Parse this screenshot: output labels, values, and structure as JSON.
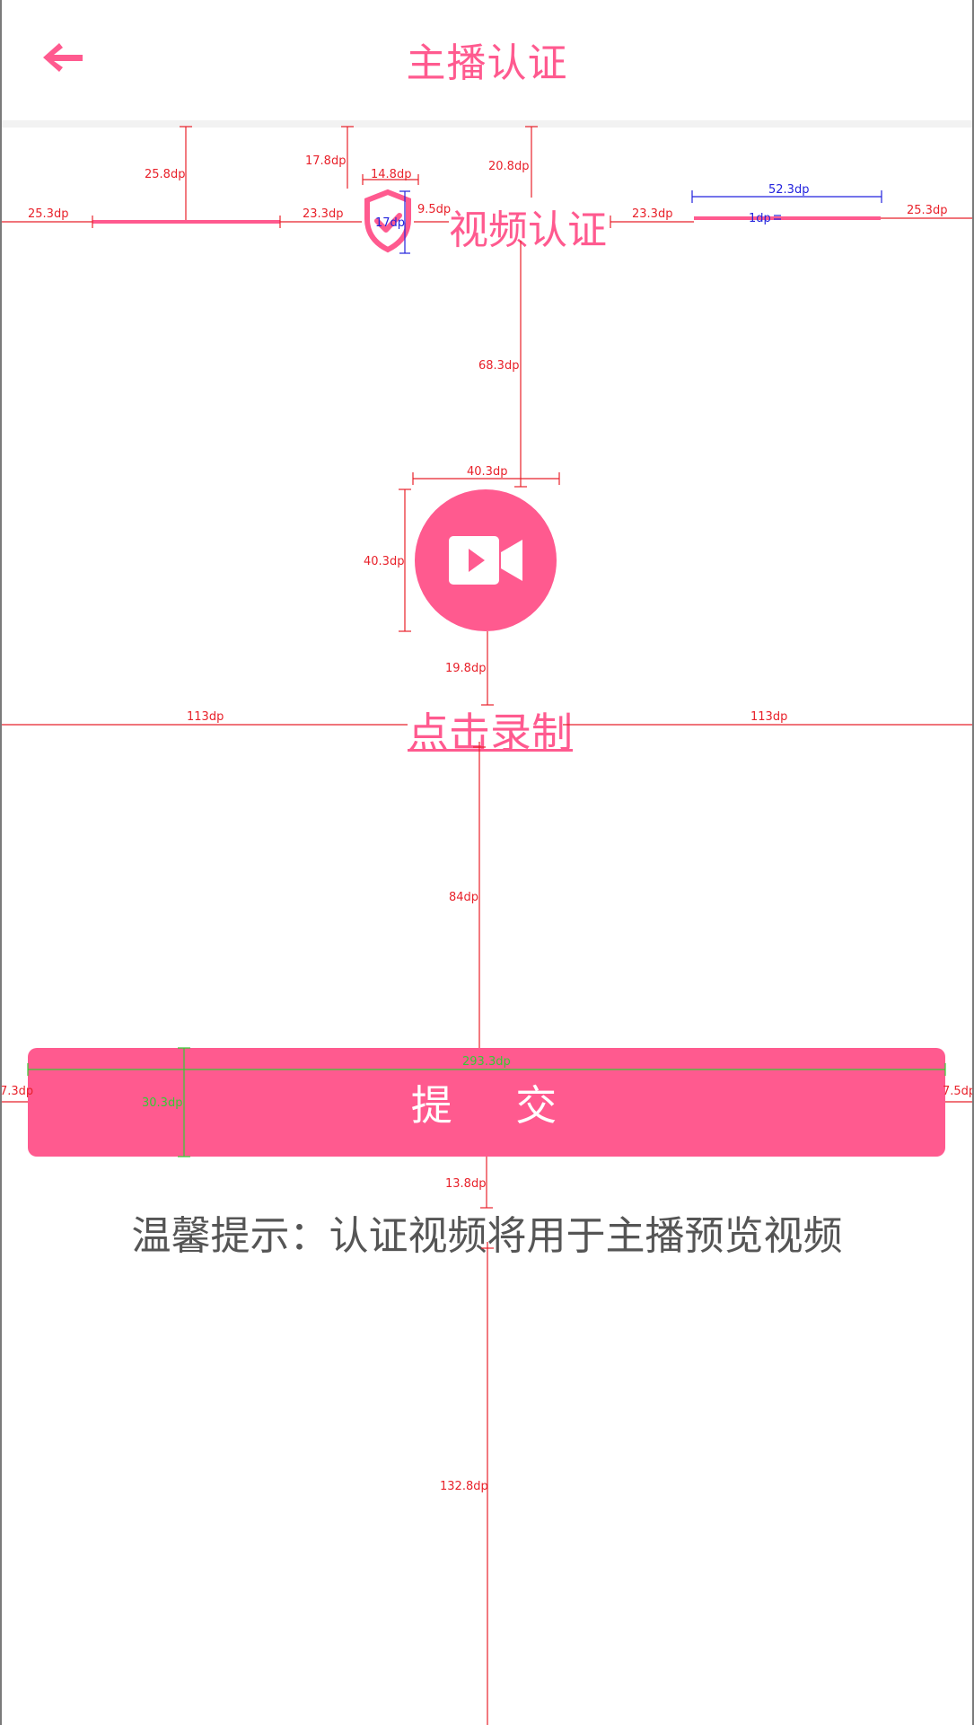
{
  "header": {
    "title": "主播认证",
    "back_icon": "arrow-left-icon"
  },
  "section": {
    "icon": "shield-check-icon",
    "title": "视频认证"
  },
  "record": {
    "icon": "video-camera-icon",
    "label": "点击录制"
  },
  "submit": {
    "label": "提 交"
  },
  "tip": {
    "text": "温馨提示：认证视频将用于主播预览视频"
  },
  "annotations": {
    "top_left_margin": "25.3dp",
    "left_line_top": "25.8dp",
    "left_line_gap": "23.3dp",
    "shield_top": "17.8dp",
    "shield_width": "14.8dp",
    "shield_height": "17dp",
    "shield_gap": "9.5dp",
    "title_top": "20.8dp",
    "right_line_gap": "23.3dp",
    "right_line_width": "52.3dp",
    "right_line_thickness": "1dp",
    "top_right_margin": "25.3dp",
    "title_to_record": "68.3dp",
    "record_width": "40.3dp",
    "record_height": "40.3dp",
    "record_to_label": "19.8dp",
    "label_left": "113dp",
    "label_right": "113dp",
    "label_to_button": "84dp",
    "button_width": "293.3dp",
    "button_height": "30.3dp",
    "button_left": "7.3dp",
    "button_right": "7.5dp",
    "button_to_tip": "13.8dp",
    "tip_to_bottom": "132.8dp"
  },
  "colors": {
    "accent": "#ff5a8f",
    "tip_text": "#555555",
    "measure_red": "#e8212a",
    "measure_blue": "#2222dd",
    "measure_green": "#33cc33"
  }
}
